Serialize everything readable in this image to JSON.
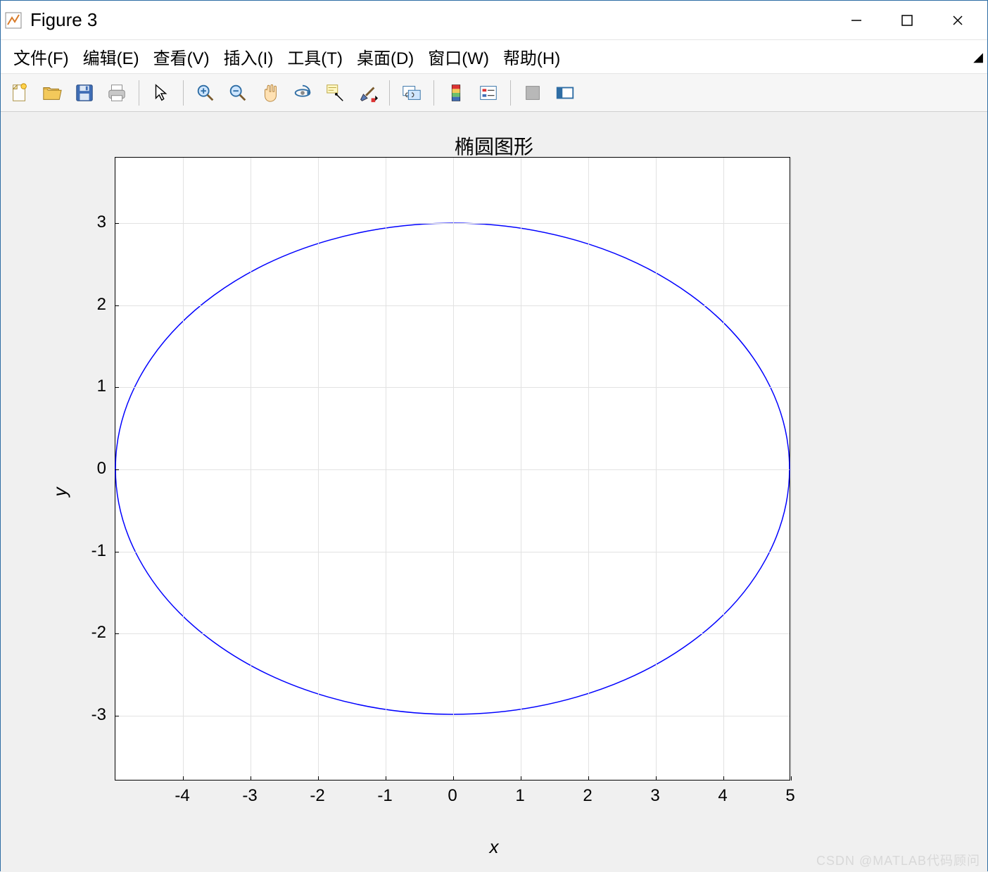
{
  "window": {
    "title": "Figure 3"
  },
  "menubar": {
    "items": [
      "文件(F)",
      "编辑(E)",
      "查看(V)",
      "插入(I)",
      "工具(T)",
      "桌面(D)",
      "窗口(W)",
      "帮助(H)"
    ]
  },
  "toolbar": {
    "buttons": [
      {
        "name": "new-figure-icon"
      },
      {
        "name": "open-icon"
      },
      {
        "name": "save-icon"
      },
      {
        "name": "print-icon"
      },
      {
        "sep": true
      },
      {
        "name": "pointer-icon"
      },
      {
        "sep": true
      },
      {
        "name": "zoom-in-icon"
      },
      {
        "name": "zoom-out-icon"
      },
      {
        "name": "pan-icon"
      },
      {
        "name": "rotate3d-icon"
      },
      {
        "name": "datacursor-icon"
      },
      {
        "name": "brush-icon"
      },
      {
        "sep": true
      },
      {
        "name": "link-icon"
      },
      {
        "sep": true
      },
      {
        "name": "colorbar-icon"
      },
      {
        "name": "legend-icon"
      },
      {
        "sep": true
      },
      {
        "name": "hide-tools-icon"
      },
      {
        "name": "show-tools-icon"
      }
    ]
  },
  "watermark": "CSDN @MATLAB代码顾问",
  "chart_data": {
    "type": "line",
    "title": "椭圆图形",
    "xlabel": "x",
    "ylabel": "y",
    "xlim": [
      -5,
      5
    ],
    "ylim": [
      -3.8,
      3.8
    ],
    "xticks": [
      -4,
      -3,
      -2,
      -1,
      0,
      1,
      2,
      3,
      4,
      5
    ],
    "yticks": [
      -3,
      -2,
      -1,
      0,
      1,
      2,
      3
    ],
    "grid": true,
    "series": [
      {
        "name": "ellipse",
        "color": "#0000ff",
        "equation": "(x/5)^2 + (y/3)^2 = 1",
        "a": 5,
        "b": 3,
        "cx": 0,
        "cy": 0
      }
    ]
  }
}
